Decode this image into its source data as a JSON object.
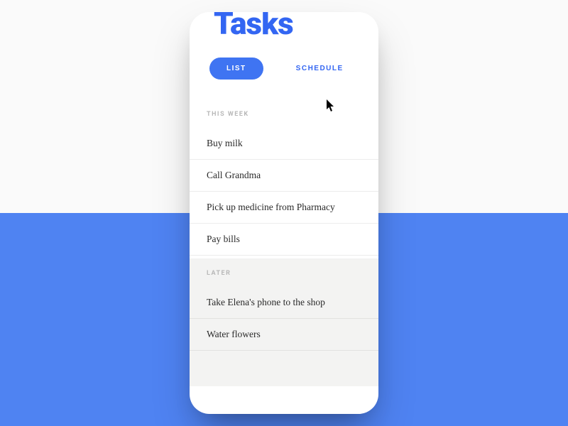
{
  "colors": {
    "accent": "#3366f2",
    "tab_active_bg": "#3f74f2",
    "bg_lower": "#4f83f2"
  },
  "app": {
    "title": "Tasks"
  },
  "tabs": {
    "list": "LIST",
    "schedule": "SCHEDULE",
    "active": "list"
  },
  "sections": {
    "this_week": {
      "label": "THIS WEEK",
      "items": [
        "Buy milk",
        "Call Grandma",
        "Pick up medicine from Pharmacy",
        "Pay bills"
      ]
    },
    "later": {
      "label": "LATER",
      "items": [
        "Take Elena's phone to the shop",
        "Water flowers"
      ]
    }
  }
}
